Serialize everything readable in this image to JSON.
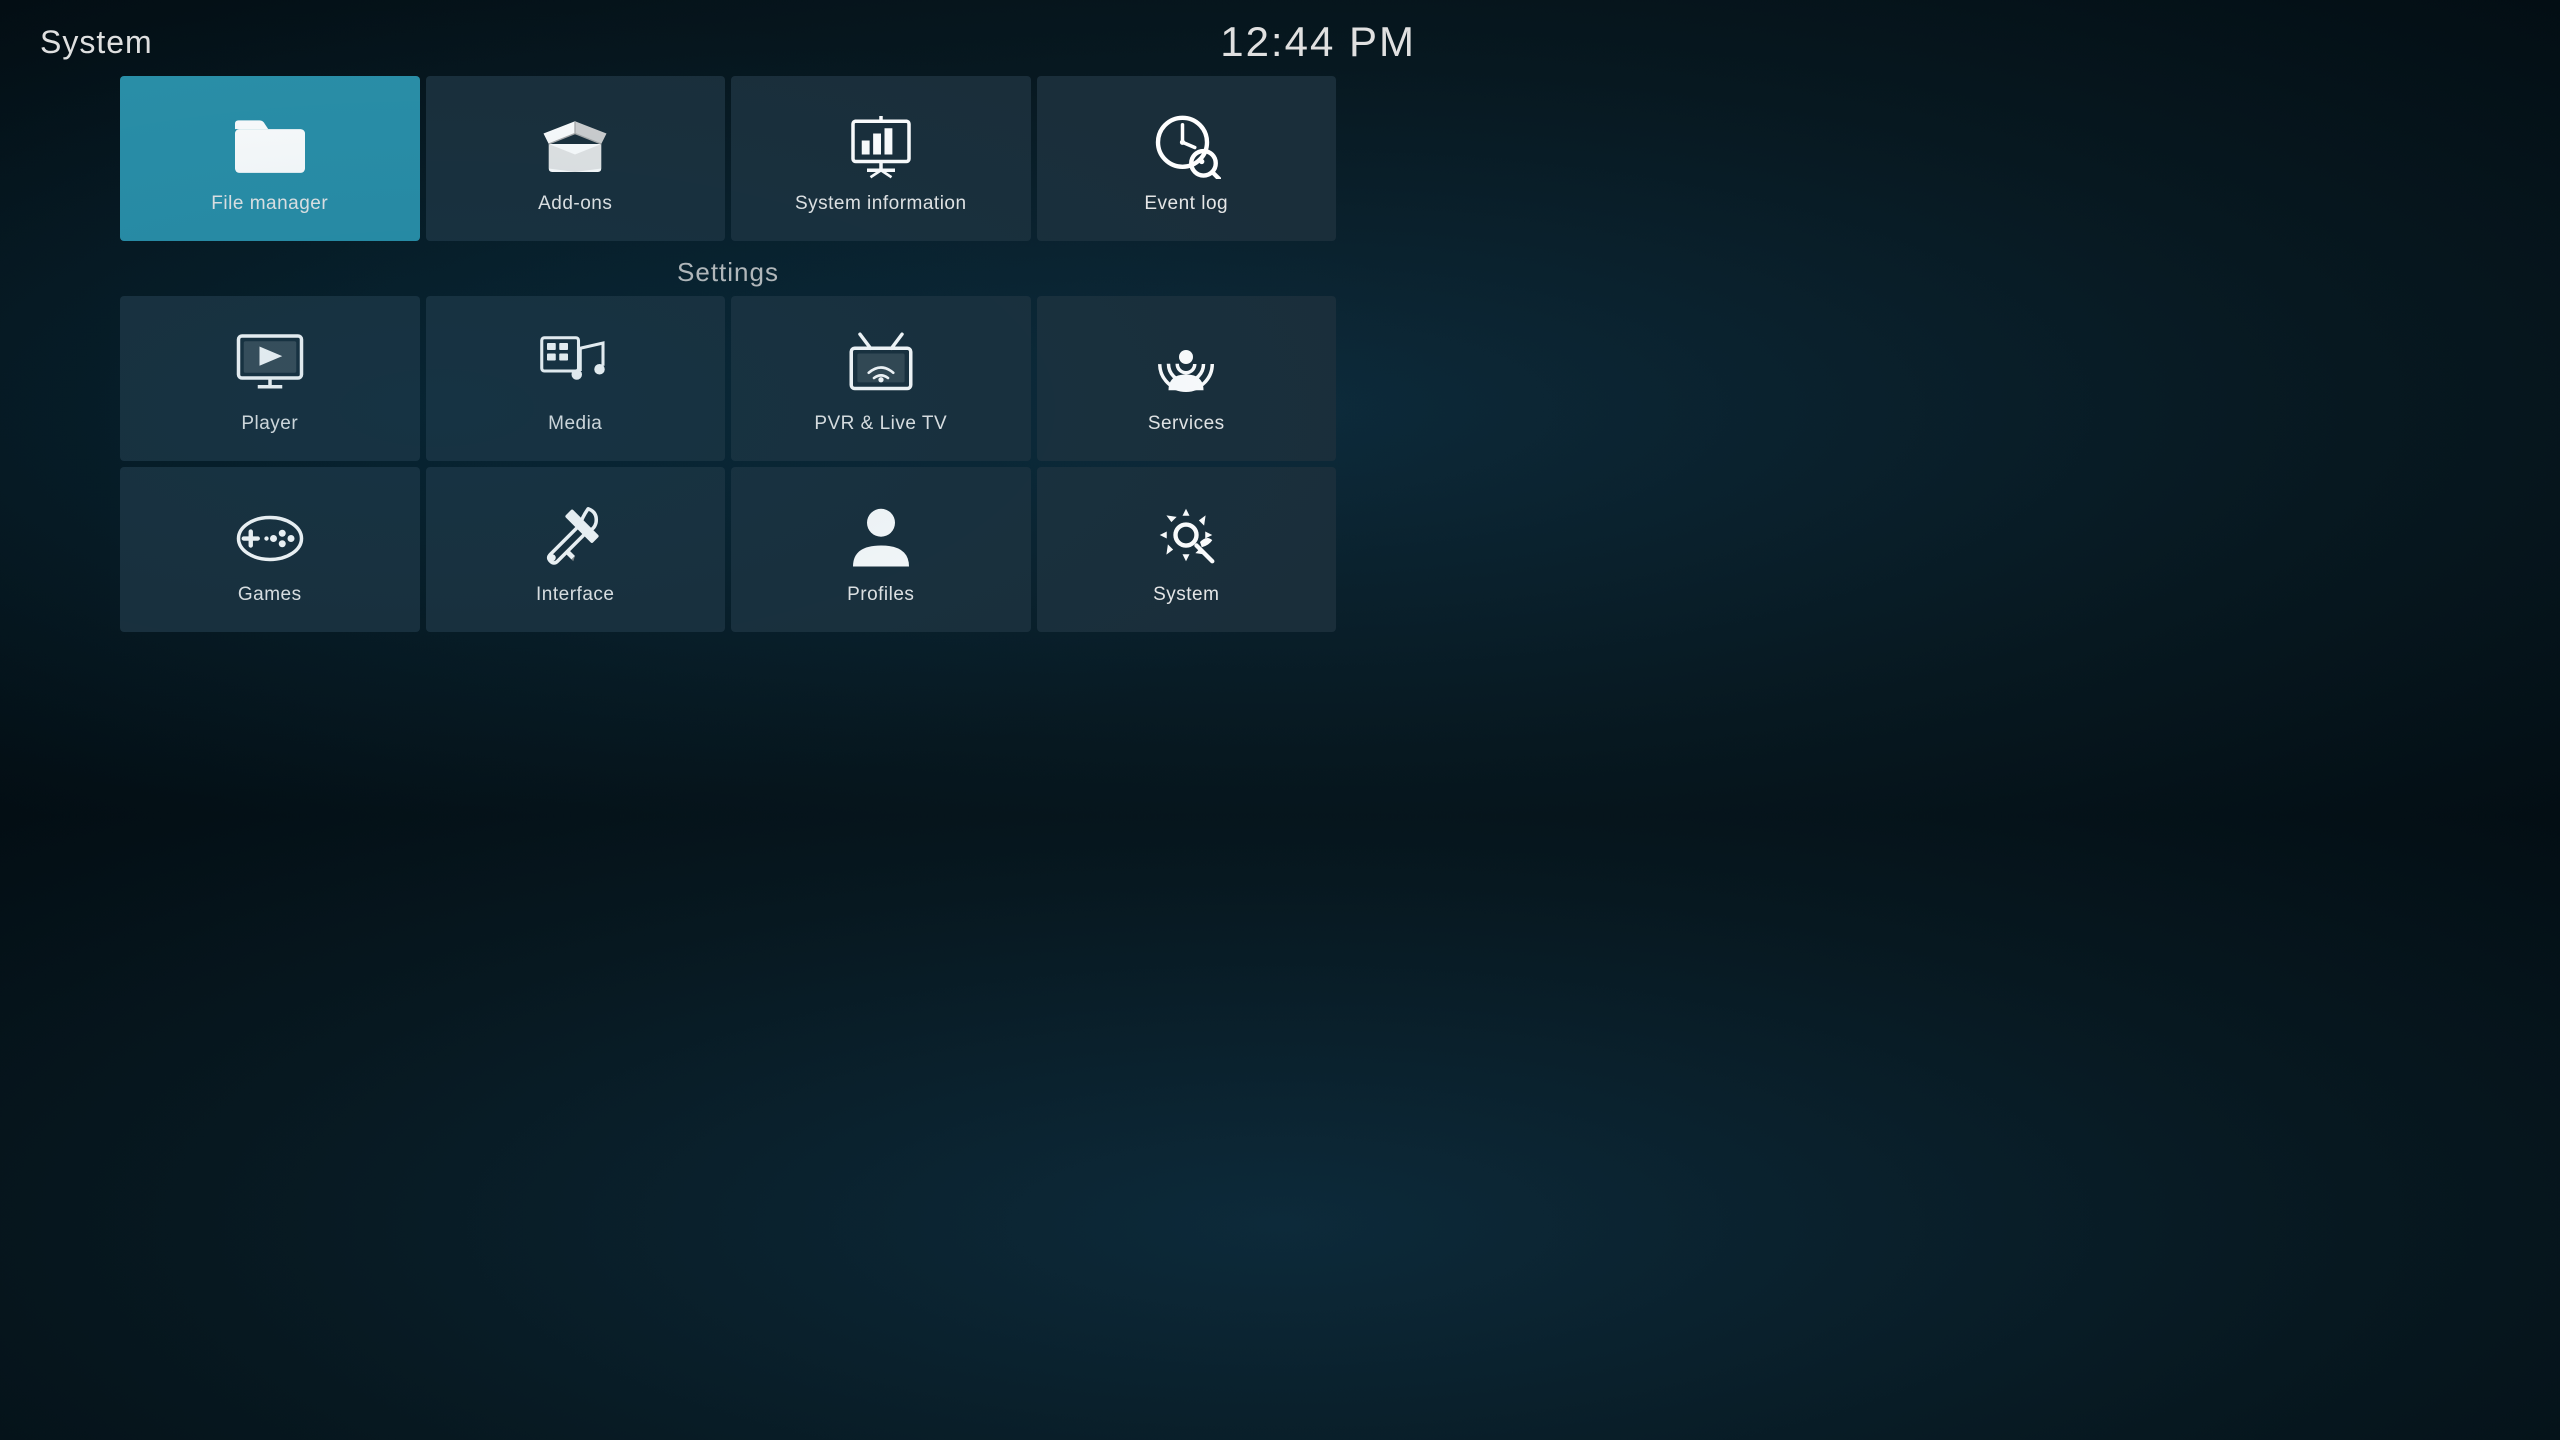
{
  "header": {
    "title": "System",
    "time": "12:44 PM"
  },
  "settings_label": "Settings",
  "top_tiles": [
    {
      "id": "file-manager",
      "label": "File manager",
      "active": true
    },
    {
      "id": "add-ons",
      "label": "Add-ons",
      "active": false
    },
    {
      "id": "system-information",
      "label": "System information",
      "active": false
    },
    {
      "id": "event-log",
      "label": "Event log",
      "active": false
    }
  ],
  "settings_tiles": [
    {
      "id": "player",
      "label": "Player"
    },
    {
      "id": "media",
      "label": "Media"
    },
    {
      "id": "pvr-live-tv",
      "label": "PVR & Live TV"
    },
    {
      "id": "services",
      "label": "Services"
    },
    {
      "id": "games",
      "label": "Games"
    },
    {
      "id": "interface",
      "label": "Interface"
    },
    {
      "id": "profiles",
      "label": "Profiles"
    },
    {
      "id": "system",
      "label": "System"
    }
  ]
}
